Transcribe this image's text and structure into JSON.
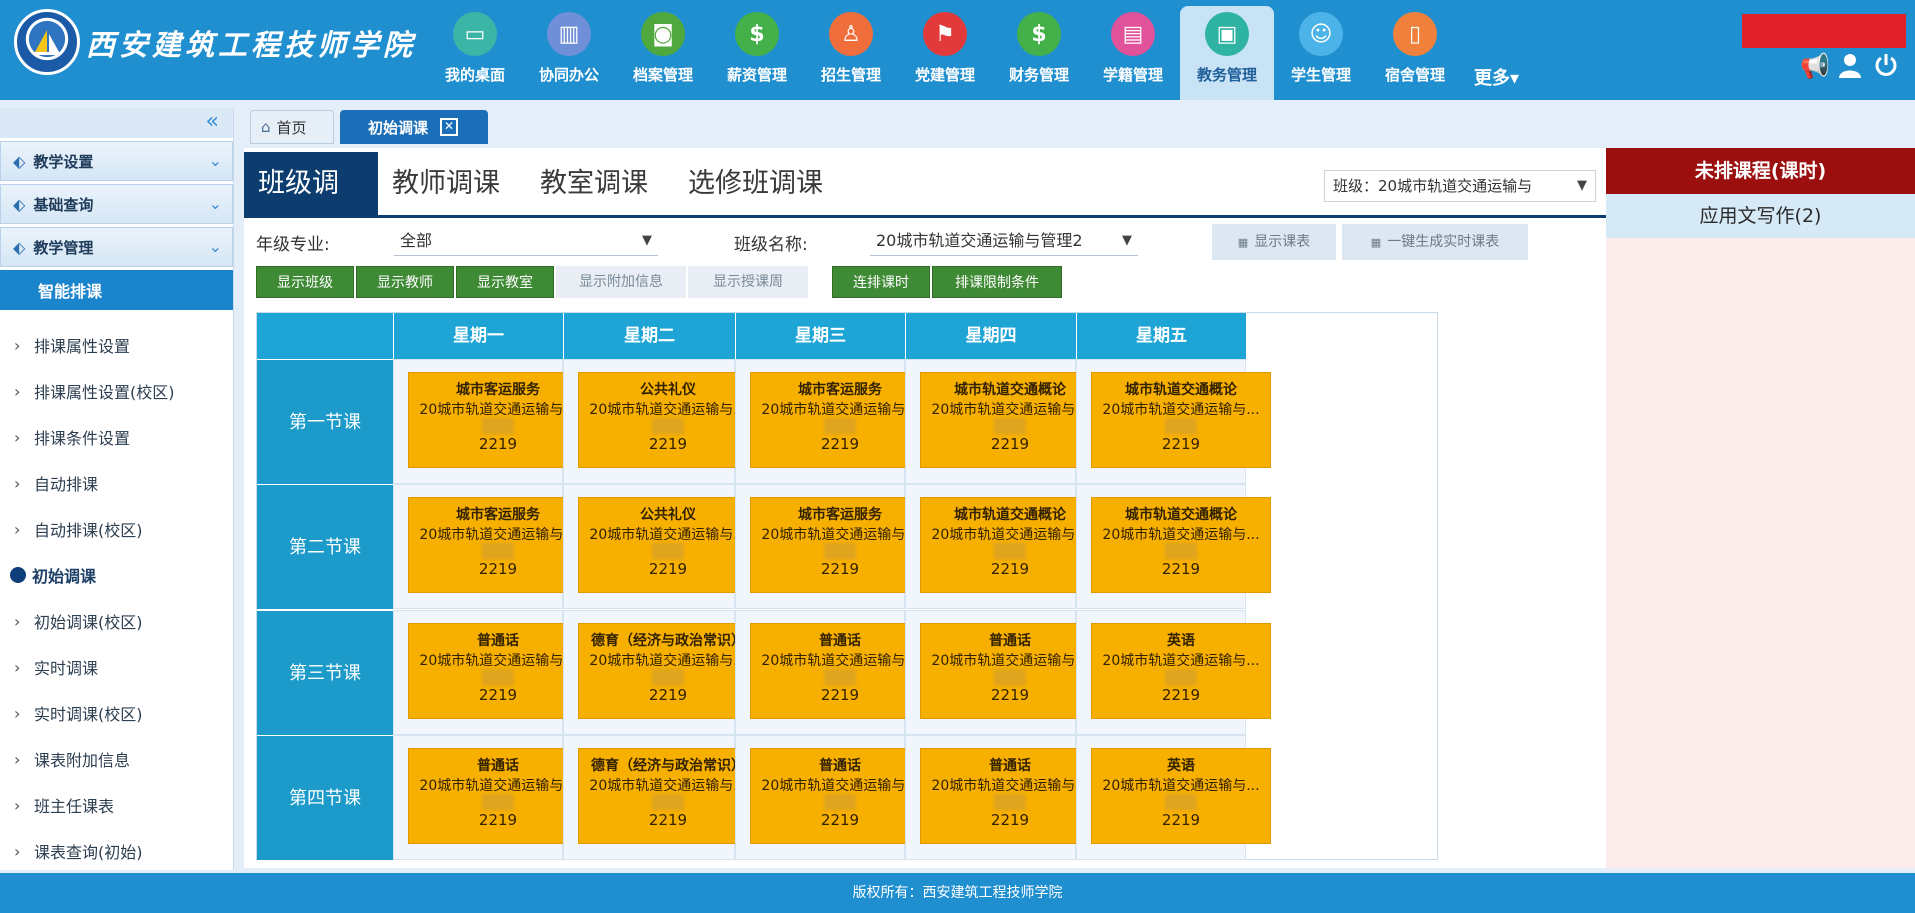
{
  "header": {
    "school_name": "西安建筑工程技师学院",
    "nav": [
      {
        "label": "我的桌面",
        "icon": "monitor-icon",
        "color": "#3bb6a6",
        "glyph": "▭"
      },
      {
        "label": "协同办公",
        "icon": "book-icon",
        "color": "#6f8fd8",
        "glyph": "▥"
      },
      {
        "label": "档案管理",
        "icon": "archive-icon",
        "color": "#4fa83e",
        "glyph": "◙"
      },
      {
        "label": "薪资管理",
        "icon": "dollar-icon",
        "color": "#44b04a",
        "glyph": "$"
      },
      {
        "label": "招生管理",
        "icon": "person-icon",
        "color": "#f06e3c",
        "glyph": "♙"
      },
      {
        "label": "党建管理",
        "icon": "flag-icon",
        "color": "#e23a3a",
        "glyph": "⚑"
      },
      {
        "label": "财务管理",
        "icon": "dollar-icon",
        "color": "#44b04a",
        "glyph": "$"
      },
      {
        "label": "学籍管理",
        "icon": "printer-icon",
        "color": "#e0529a",
        "glyph": "▤"
      },
      {
        "label": "教务管理",
        "icon": "image-icon",
        "color": "#2fb3a3",
        "glyph": "▣"
      },
      {
        "label": "学生管理",
        "icon": "people-icon",
        "color": "#4bb3e8",
        "glyph": "☺"
      },
      {
        "label": "宿舍管理",
        "icon": "document-icon",
        "color": "#f0813c",
        "glyph": "▯"
      }
    ],
    "active_nav": "教务管理",
    "more_label": "更多▾"
  },
  "sidebar": {
    "sections": [
      "教学设置",
      "基础查询",
      "教学管理"
    ],
    "smart_label": "智能排课",
    "items": [
      "排课属性设置",
      "排课属性设置(校区)",
      "排课条件设置",
      "自动排课",
      "自动排课(校区)",
      "初始调课",
      "初始调课(校区)",
      "实时调课",
      "实时调课(校区)",
      "课表附加信息",
      "班主任课表",
      "课表查询(初始)"
    ],
    "active_item": "初始调课"
  },
  "tabs": {
    "home": "首页",
    "current": "初始调课"
  },
  "main": {
    "mode_tabs": [
      "班级调课",
      "教师调课",
      "教室调课",
      "选修班调课"
    ],
    "class_select": "班级：20城市轨道交通运输与",
    "grade_label": "年级专业:",
    "grade_value": "全部",
    "classname_label": "班级名称:",
    "classname_value": "20城市轨道交通运输与管理2",
    "show_timetable": "显示课表",
    "generate_timetable": "一键生成实时课表",
    "buttons": {
      "show_class": "显示班级",
      "show_teacher": "显示教师",
      "show_room": "显示教室",
      "show_extra": "显示附加信息",
      "show_weeks": "显示授课周",
      "consecutive": "连排课时",
      "constraints": "排课限制条件"
    }
  },
  "timetable": {
    "days": [
      "星期一",
      "星期二",
      "星期三",
      "星期四",
      "星期五"
    ],
    "periods": [
      "第一节课",
      "第二节课",
      "第三节课",
      "第四节课"
    ],
    "grid": [
      [
        {
          "course": "城市客运服务",
          "class": "20城市轨道交通运输与...",
          "room": "2219"
        },
        {
          "course": "公共礼仪",
          "class": "20城市轨道交通运输与...",
          "room": "2219"
        },
        {
          "course": "城市客运服务",
          "class": "20城市轨道交通运输与...",
          "room": "2219"
        },
        {
          "course": "城市轨道交通概论",
          "class": "20城市轨道交通运输与...",
          "room": "2219"
        },
        {
          "course": "城市轨道交通概论",
          "class": "20城市轨道交通运输与...",
          "room": "2219"
        }
      ],
      [
        {
          "course": "城市客运服务",
          "class": "20城市轨道交通运输与...",
          "room": "2219"
        },
        {
          "course": "公共礼仪",
          "class": "20城市轨道交通运输与...",
          "room": "2219"
        },
        {
          "course": "城市客运服务",
          "class": "20城市轨道交通运输与...",
          "room": "2219"
        },
        {
          "course": "城市轨道交通概论",
          "class": "20城市轨道交通运输与...",
          "room": "2219"
        },
        {
          "course": "城市轨道交通概论",
          "class": "20城市轨道交通运输与...",
          "room": "2219"
        }
      ],
      [
        {
          "course": "普通话",
          "class": "20城市轨道交通运输与...",
          "room": "2219"
        },
        {
          "course": "德育（经济与政治常识）",
          "class": "20城市轨道交通运输与...",
          "room": "2219"
        },
        {
          "course": "普通话",
          "class": "20城市轨道交通运输与...",
          "room": "2219"
        },
        {
          "course": "普通话",
          "class": "20城市轨道交通运输与...",
          "room": "2219"
        },
        {
          "course": "英语",
          "class": "20城市轨道交通运输与...",
          "room": "2219"
        }
      ],
      [
        {
          "course": "普通话",
          "class": "20城市轨道交通运输与...",
          "room": "2219"
        },
        {
          "course": "德育（经济与政治常识）",
          "class": "20城市轨道交通运输与...",
          "room": "2219"
        },
        {
          "course": "普通话",
          "class": "20城市轨道交通运输与...",
          "room": "2219"
        },
        {
          "course": "普通话",
          "class": "20城市轨道交通运输与...",
          "room": "2219"
        },
        {
          "course": "英语",
          "class": "20城市轨道交通运输与...",
          "room": "2219"
        }
      ]
    ]
  },
  "right_panel": {
    "title": "未排课程(课时)",
    "items": [
      "应用文写作(2)"
    ]
  },
  "footer": "版权所有：西安建筑工程技师学院",
  "colors": {
    "header_blue": "#1f8fd0",
    "card_yellow": "#f8b000",
    "active_green": "#3f8a35",
    "unscheduled_red": "#9b0f0f"
  }
}
